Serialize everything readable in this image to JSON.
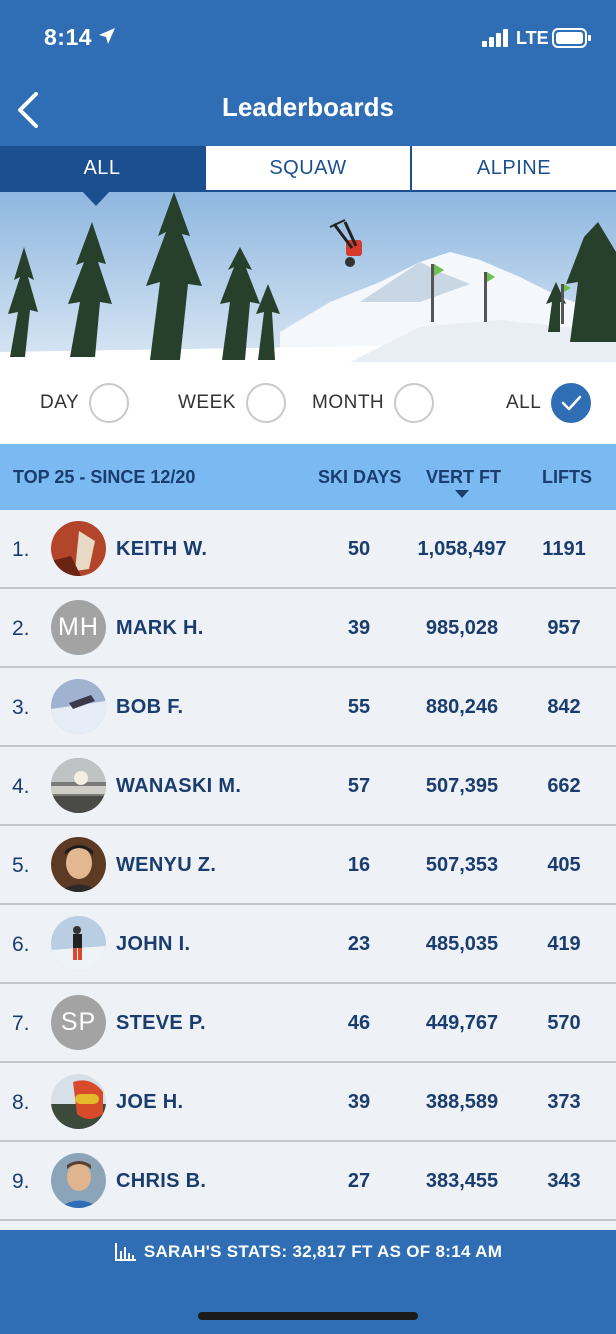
{
  "status": {
    "time": "8:14",
    "network": "LTE"
  },
  "header": {
    "title": "Leaderboards"
  },
  "tabs": [
    {
      "label": "ALL",
      "active": true
    },
    {
      "label": "SQUAW",
      "active": false
    },
    {
      "label": "ALPINE",
      "active": false
    }
  ],
  "period": {
    "options": [
      {
        "label": "DAY",
        "checked": false
      },
      {
        "label": "WEEK",
        "checked": false
      },
      {
        "label": "MONTH",
        "checked": false
      },
      {
        "label": "ALL",
        "checked": true
      }
    ]
  },
  "table": {
    "headers": {
      "range": "TOP 25 - SINCE 12/20",
      "days": "SKI DAYS",
      "vert": "VERT FT",
      "lifts": "LIFTS"
    },
    "sorted_by": "VERT FT",
    "rows": [
      {
        "rank": "1.",
        "name": "KEITH W.",
        "initials": "",
        "days": "50",
        "vert": "1,058,497",
        "lifts": "1191"
      },
      {
        "rank": "2.",
        "name": "MARK H.",
        "initials": "MH",
        "days": "39",
        "vert": "985,028",
        "lifts": "957"
      },
      {
        "rank": "3.",
        "name": "BOB F.",
        "initials": "",
        "days": "55",
        "vert": "880,246",
        "lifts": "842"
      },
      {
        "rank": "4.",
        "name": "WANASKI M.",
        "initials": "",
        "days": "57",
        "vert": "507,395",
        "lifts": "662"
      },
      {
        "rank": "5.",
        "name": "WENYU Z.",
        "initials": "",
        "days": "16",
        "vert": "507,353",
        "lifts": "405"
      },
      {
        "rank": "6.",
        "name": "JOHN I.",
        "initials": "",
        "days": "23",
        "vert": "485,035",
        "lifts": "419"
      },
      {
        "rank": "7.",
        "name": "STEVE P.",
        "initials": "SP",
        "days": "46",
        "vert": "449,767",
        "lifts": "570"
      },
      {
        "rank": "8.",
        "name": "JOE H.",
        "initials": "",
        "days": "39",
        "vert": "388,589",
        "lifts": "373"
      },
      {
        "rank": "9.",
        "name": "CHRIS B.",
        "initials": "",
        "days": "27",
        "vert": "383,455",
        "lifts": "343"
      }
    ]
  },
  "footer": {
    "stats": "SARAH'S STATS: 32,817 FT AS OF 8:14 AM"
  },
  "colors": {
    "header_blue": "#2f6eb5",
    "tab_navy": "#1c4f8f",
    "table_header": "#7ab9f2",
    "text_navy": "#1a3d6e"
  }
}
